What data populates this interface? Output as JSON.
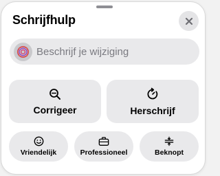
{
  "app": {
    "title": "Schrijfhulp"
  },
  "header": {
    "close_icon": "close-icon"
  },
  "prompt": {
    "placeholder": "Beschrijf je wijziging",
    "logo_icon": "writing-tools-logo-icon"
  },
  "actions": [
    {
      "label": "Corrigeer",
      "icon": "magnifier-check-icon"
    },
    {
      "label": "Herschrijf",
      "icon": "rewrite-arrow-icon"
    }
  ],
  "tones": [
    {
      "label": "Vriendelijk",
      "icon": "smiley-icon"
    },
    {
      "label": "Professioneel",
      "icon": "briefcase-icon"
    },
    {
      "label": "Beknopt",
      "icon": "concise-icon"
    }
  ],
  "colors": {
    "panel": "#ffffff",
    "tile": "#e9e9eb",
    "logo_accent": "#d33c6d"
  }
}
